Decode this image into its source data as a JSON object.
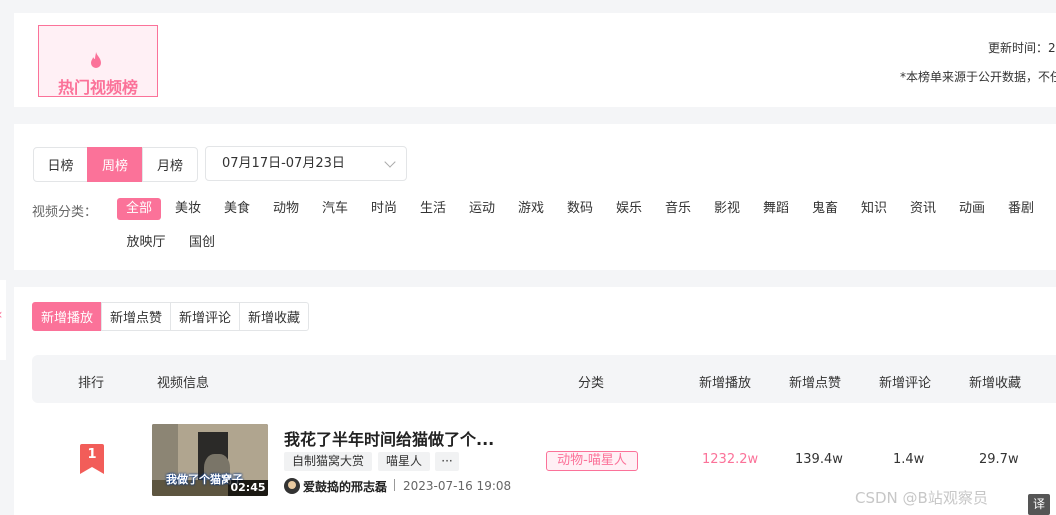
{
  "header": {
    "title": "热门视频榜",
    "update_time": "更新时间：2",
    "disclaimer": "*本榜单来源于公开数据，不任"
  },
  "filters": {
    "periods": [
      "日榜",
      "周榜",
      "月榜"
    ],
    "active_period": "周榜",
    "date_range": "07月17日-07月23日",
    "category_label": "视频分类：",
    "categories": [
      "全部",
      "美妆",
      "美食",
      "动物",
      "汽车",
      "时尚",
      "生活",
      "运动",
      "游戏",
      "数码",
      "娱乐",
      "音乐",
      "影视",
      "舞蹈",
      "鬼畜",
      "知识",
      "资讯",
      "动画",
      "番剧",
      "放映厅",
      "国创"
    ],
    "active_category": "全部"
  },
  "metric_tabs": [
    "新增播放",
    "新增点赞",
    "新增评论",
    "新增收藏"
  ],
  "active_metric": "新增播放",
  "table": {
    "columns": [
      "排行",
      "视频信息",
      "分类",
      "新增播放",
      "新增点赞",
      "新增评论",
      "新增收藏"
    ],
    "rows": [
      {
        "rank": "1",
        "title": "我花了半年时间给猫做了个...",
        "thumb_caption": "我做了个猫窝子",
        "duration": "02:45",
        "tags": [
          "自制猫窝大赏",
          "喵星人",
          "···"
        ],
        "author": "爱鼓捣的邢志磊",
        "date": "2023-07-16 19:08",
        "category": "动物-喵星人",
        "plays": "1232.2w",
        "likes": "139.4w",
        "comments": "1.4w",
        "favorites": "29.7w"
      }
    ]
  },
  "watermark": "CSDN @B站观察员",
  "colors": {
    "accent": "#fb7299",
    "bg": "#f4f5f7"
  }
}
